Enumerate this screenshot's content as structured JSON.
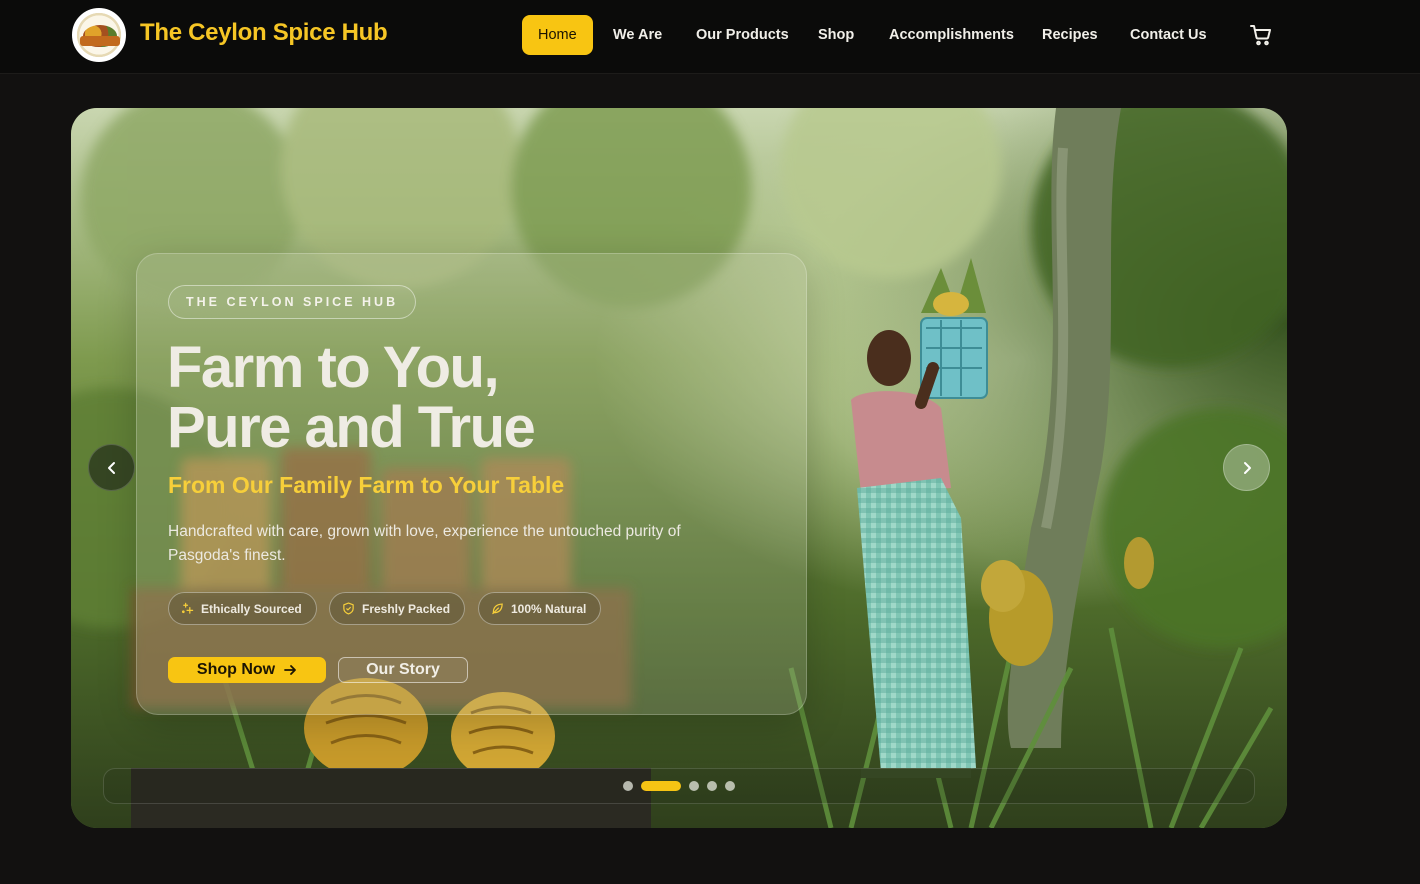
{
  "header": {
    "brand": "The Ceylon Spice Hub",
    "nav": [
      {
        "label": "Home",
        "active": true
      },
      {
        "label": "We Are",
        "active": false
      },
      {
        "label": "Our Products",
        "active": false
      },
      {
        "label": "Shop",
        "active": false
      },
      {
        "label": "Accomplishments",
        "active": false
      },
      {
        "label": "Recipes",
        "active": false
      },
      {
        "label": "Contact Us",
        "active": false
      }
    ],
    "cart_icon": "cart-icon"
  },
  "hero": {
    "eyebrow": "THE CEYLON SPICE HUB",
    "headline_line1": "Farm to You,",
    "headline_line2": "Pure and True",
    "subheadline": "From Our Family Farm to Your Table",
    "description": "Handcrafted with care, grown with love, experience the untouched purity of Pasgoda's finest.",
    "features": [
      {
        "label": "Ethically Sourced",
        "icon": "sparkle-icon"
      },
      {
        "label": "Freshly Packed",
        "icon": "shield-icon"
      },
      {
        "label": "100% Natural",
        "icon": "leaf-icon"
      }
    ],
    "primary_cta": "Shop Now",
    "secondary_cta": "Our Story",
    "slides_total": 5,
    "active_slide": 2
  },
  "colors": {
    "accent": "#F8C512",
    "background": "#121110",
    "header_bg": "#0B0B0A",
    "subheadline": "#F7CF3A"
  }
}
